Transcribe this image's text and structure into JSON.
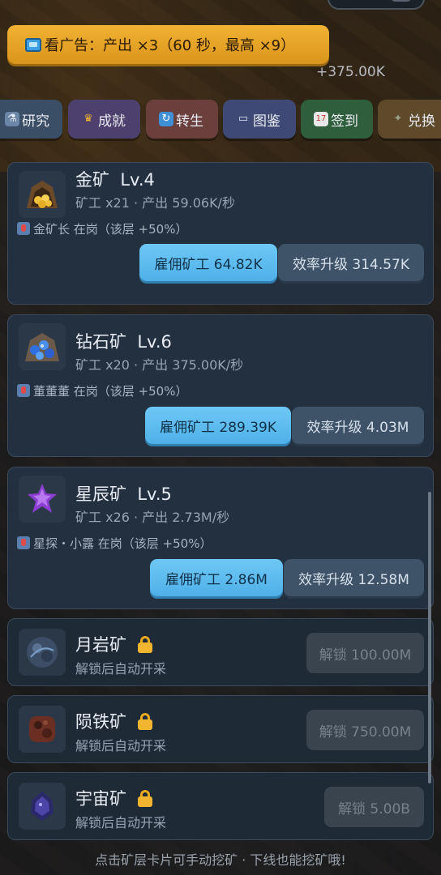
{
  "ad": {
    "label": "看广告：产出 ×3（60 秒，最高 ×9）"
  },
  "income_popup": "+375.00K",
  "nav": [
    {
      "label": "研究",
      "icon": "microscope-icon"
    },
    {
      "label": "成就",
      "icon": "trophy-icon"
    },
    {
      "label": "转生",
      "icon": "cycle-icon"
    },
    {
      "label": "图鉴",
      "icon": "book-icon"
    },
    {
      "label": "签到",
      "icon": "calendar-icon"
    },
    {
      "label": "兑换",
      "icon": "gift-icon"
    }
  ],
  "mines": [
    {
      "name": "金矿",
      "level": "Lv.4",
      "stats": "矿工 x21 · 产出 59.06K/秒",
      "boost": "金矿长 在岗（该层 +50%）",
      "hire": "雇佣矿工  64.82K",
      "upgrade": "效率升级  314.57K",
      "icon": "gold-ore-icon"
    },
    {
      "name": "钻石矿",
      "level": "Lv.6",
      "stats": "矿工 x20 · 产出 375.00K/秒",
      "boost": "董董董 在岗（该层 +50%）",
      "hire": "雇佣矿工  289.39K",
      "upgrade": "效率升级  4.03M",
      "icon": "diamond-ore-icon"
    },
    {
      "name": "星辰矿",
      "level": "Lv.5",
      "stats": "矿工 x26 · 产出 2.73M/秒",
      "boost": "星探・小露 在岗（该层 +50%）",
      "hire": "雇佣矿工  2.86M",
      "upgrade": "效率升级  12.58M",
      "icon": "star-ore-icon"
    }
  ],
  "locked_mines": [
    {
      "name": "月岩矿",
      "desc": "解锁后自动开采",
      "unlock": "解锁  100.00M",
      "icon": "moonrock-icon"
    },
    {
      "name": "陨铁矿",
      "desc": "解锁后自动开采",
      "unlock": "解锁  750.00M",
      "icon": "meteorite-icon"
    },
    {
      "name": "宇宙矿",
      "desc": "解锁后自动开采",
      "unlock": "解锁  5.00B",
      "icon": "cosmic-ore-icon"
    }
  ],
  "footer": "点击矿层卡片可手动挖矿 · 下线也能挖矿哦!",
  "colors": {
    "accent": "#4fb0e8",
    "ad": "#f2b233",
    "lock": "#f2b530"
  }
}
